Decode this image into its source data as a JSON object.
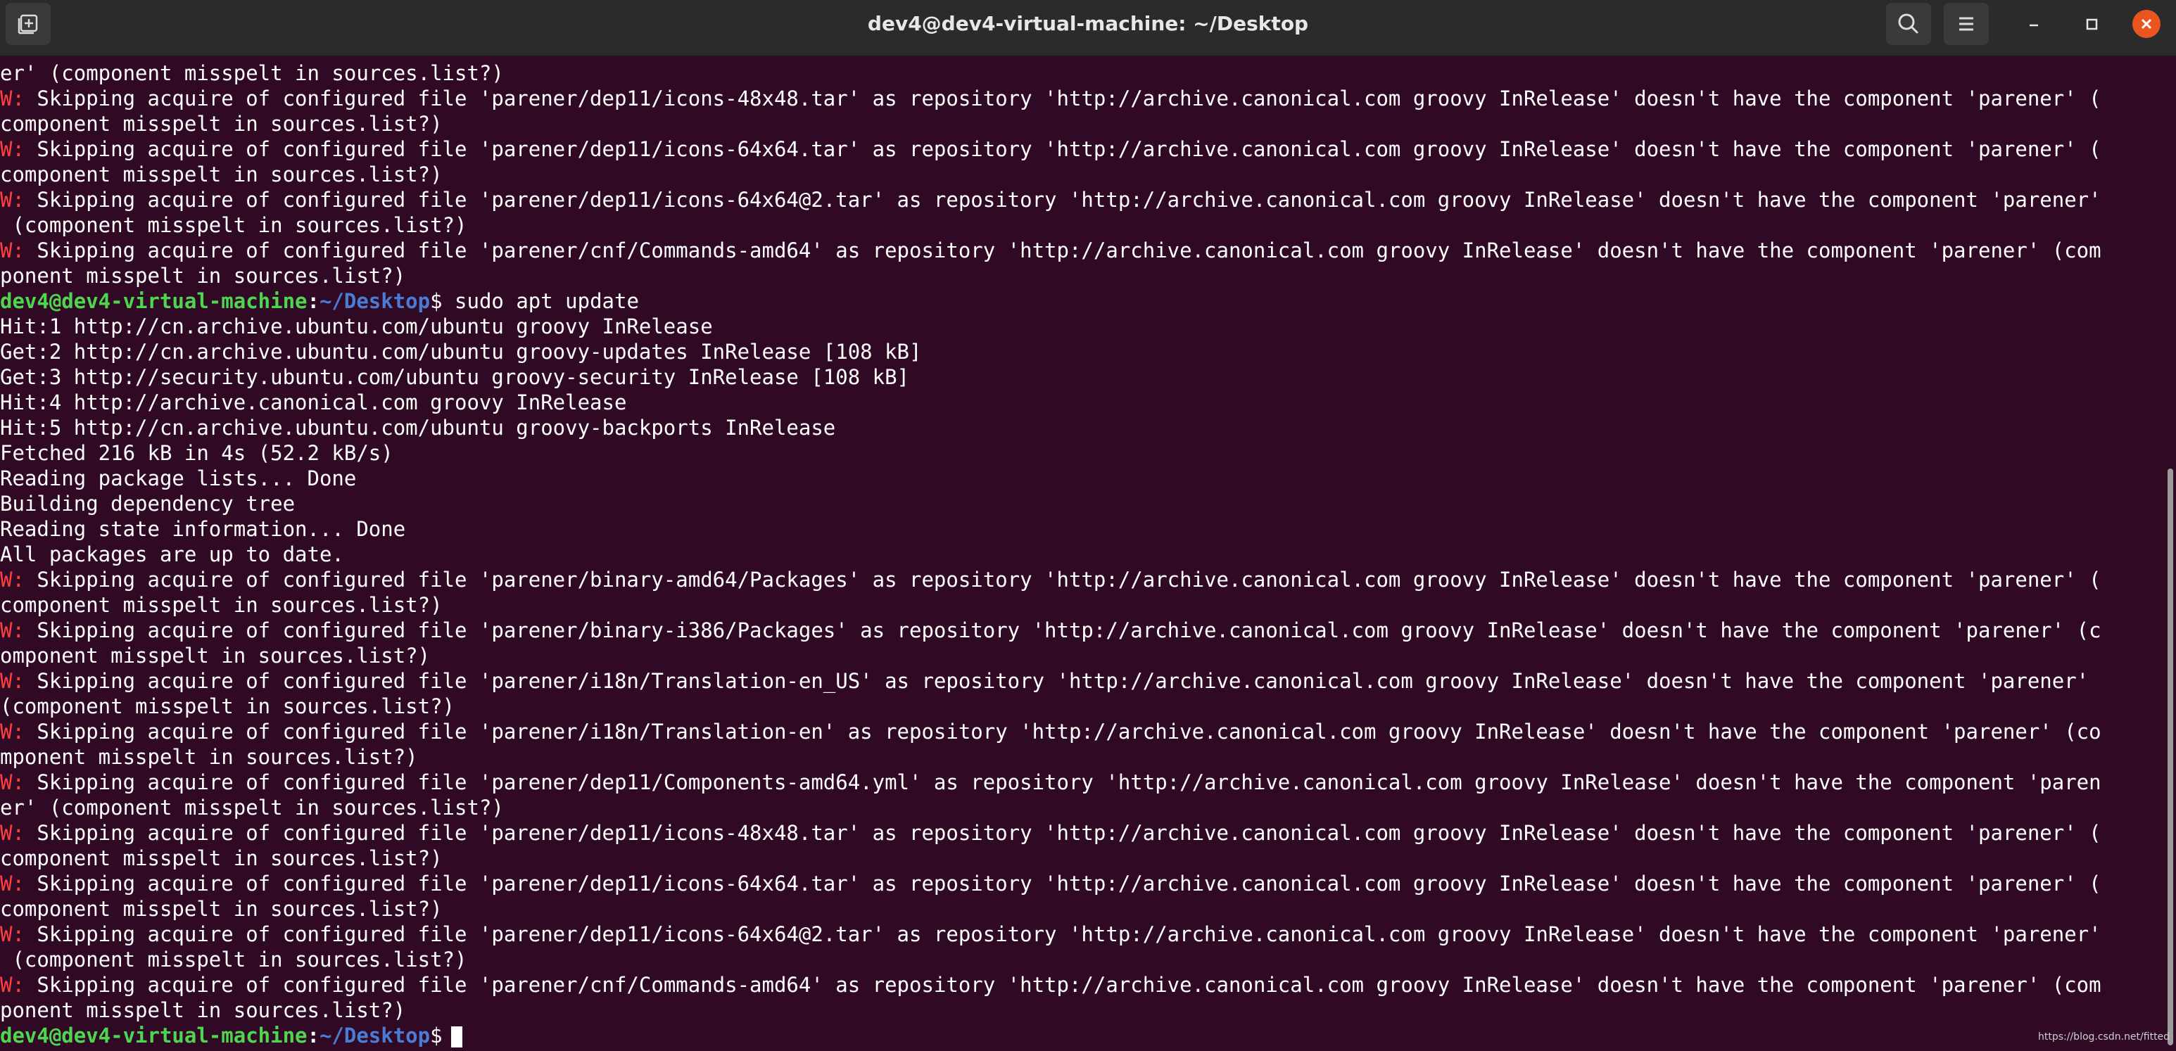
{
  "window": {
    "title": "dev4@dev4-virtual-machine: ~/Desktop"
  },
  "titlebar": {
    "icons": {
      "new_tab": "new-tab-icon",
      "search": "search-icon",
      "menu": "hamburger-menu-icon",
      "minimize": "minimize-icon",
      "maximize": "maximize-icon",
      "close": "close-icon"
    }
  },
  "colors": {
    "terminal_background": "#300a24",
    "titlebar_background": "#2b2b2b",
    "prompt_user": "#4fd64f",
    "prompt_path": "#4a7cd6",
    "warning_prefix": "#ff4040",
    "close_button": "#e95420"
  },
  "terminal": {
    "lines": [
      {
        "kind": "wrap",
        "text": "er' (component misspelt in sources.list?)"
      },
      {
        "kind": "warn",
        "prefix": "W:",
        "text": " Skipping acquire of configured file 'parener/dep11/icons-48x48.tar' as repository 'http://archive.canonical.com groovy InRelease' doesn't have the component 'parener' ("
      },
      {
        "kind": "wrap",
        "text": "component misspelt in sources.list?)"
      },
      {
        "kind": "warn",
        "prefix": "W:",
        "text": " Skipping acquire of configured file 'parener/dep11/icons-64x64.tar' as repository 'http://archive.canonical.com groovy InRelease' doesn't have the component 'parener' ("
      },
      {
        "kind": "wrap",
        "text": "component misspelt in sources.list?)"
      },
      {
        "kind": "warn",
        "prefix": "W:",
        "text": " Skipping acquire of configured file 'parener/dep11/icons-64x64@2.tar' as repository 'http://archive.canonical.com groovy InRelease' doesn't have the component 'parener'"
      },
      {
        "kind": "wrap",
        "text": " (component misspelt in sources.list?)"
      },
      {
        "kind": "warn",
        "prefix": "W:",
        "text": " Skipping acquire of configured file 'parener/cnf/Commands-amd64' as repository 'http://archive.canonical.com groovy InRelease' doesn't have the component 'parener' (com"
      },
      {
        "kind": "wrap",
        "text": "ponent misspelt in sources.list?)"
      },
      {
        "kind": "prompt",
        "user": "dev4@dev4-virtual-machine",
        "colon": ":",
        "path": "~/Desktop",
        "dollar": "$",
        "command": " sudo apt update"
      },
      {
        "kind": "out",
        "text": "Hit:1 http://cn.archive.ubuntu.com/ubuntu groovy InRelease"
      },
      {
        "kind": "out",
        "text": "Get:2 http://cn.archive.ubuntu.com/ubuntu groovy-updates InRelease [108 kB]"
      },
      {
        "kind": "out",
        "text": "Get:3 http://security.ubuntu.com/ubuntu groovy-security InRelease [108 kB]"
      },
      {
        "kind": "out",
        "text": "Hit:4 http://archive.canonical.com groovy InRelease"
      },
      {
        "kind": "out",
        "text": "Hit:5 http://cn.archive.ubuntu.com/ubuntu groovy-backports InRelease"
      },
      {
        "kind": "out",
        "text": "Fetched 216 kB in 4s (52.2 kB/s)"
      },
      {
        "kind": "out",
        "text": "Reading package lists... Done"
      },
      {
        "kind": "out",
        "text": "Building dependency tree"
      },
      {
        "kind": "out",
        "text": "Reading state information... Done"
      },
      {
        "kind": "out",
        "text": "All packages are up to date."
      },
      {
        "kind": "warn",
        "prefix": "W:",
        "text": " Skipping acquire of configured file 'parener/binary-amd64/Packages' as repository 'http://archive.canonical.com groovy InRelease' doesn't have the component 'parener' ("
      },
      {
        "kind": "wrap",
        "text": "component misspelt in sources.list?)"
      },
      {
        "kind": "warn",
        "prefix": "W:",
        "text": " Skipping acquire of configured file 'parener/binary-i386/Packages' as repository 'http://archive.canonical.com groovy InRelease' doesn't have the component 'parener' (c"
      },
      {
        "kind": "wrap",
        "text": "omponent misspelt in sources.list?)"
      },
      {
        "kind": "warn",
        "prefix": "W:",
        "text": " Skipping acquire of configured file 'parener/i18n/Translation-en_US' as repository 'http://archive.canonical.com groovy InRelease' doesn't have the component 'parener'"
      },
      {
        "kind": "wrap",
        "text": "(component misspelt in sources.list?)"
      },
      {
        "kind": "warn",
        "prefix": "W:",
        "text": " Skipping acquire of configured file 'parener/i18n/Translation-en' as repository 'http://archive.canonical.com groovy InRelease' doesn't have the component 'parener' (co"
      },
      {
        "kind": "wrap",
        "text": "mponent misspelt in sources.list?)"
      },
      {
        "kind": "warn",
        "prefix": "W:",
        "text": " Skipping acquire of configured file 'parener/dep11/Components-amd64.yml' as repository 'http://archive.canonical.com groovy InRelease' doesn't have the component 'paren"
      },
      {
        "kind": "wrap",
        "text": "er' (component misspelt in sources.list?)"
      },
      {
        "kind": "warn",
        "prefix": "W:",
        "text": " Skipping acquire of configured file 'parener/dep11/icons-48x48.tar' as repository 'http://archive.canonical.com groovy InRelease' doesn't have the component 'parener' ("
      },
      {
        "kind": "wrap",
        "text": "component misspelt in sources.list?)"
      },
      {
        "kind": "warn",
        "prefix": "W:",
        "text": " Skipping acquire of configured file 'parener/dep11/icons-64x64.tar' as repository 'http://archive.canonical.com groovy InRelease' doesn't have the component 'parener' ("
      },
      {
        "kind": "wrap",
        "text": "component misspelt in sources.list?)"
      },
      {
        "kind": "warn",
        "prefix": "W:",
        "text": " Skipping acquire of configured file 'parener/dep11/icons-64x64@2.tar' as repository 'http://archive.canonical.com groovy InRelease' doesn't have the component 'parener'"
      },
      {
        "kind": "wrap",
        "text": " (component misspelt in sources.list?)"
      },
      {
        "kind": "warn",
        "prefix": "W:",
        "text": " Skipping acquire of configured file 'parener/cnf/Commands-amd64' as repository 'http://archive.canonical.com groovy InRelease' doesn't have the component 'parener' (com"
      },
      {
        "kind": "wrap",
        "text": "ponent misspelt in sources.list?)"
      },
      {
        "kind": "prompt",
        "user": "dev4@dev4-virtual-machine",
        "colon": ":",
        "path": "~/Desktop",
        "dollar": "$",
        "command": "",
        "cursor": true
      }
    ]
  },
  "watermark": {
    "text": "https://blog.csdn.net/fitted"
  }
}
